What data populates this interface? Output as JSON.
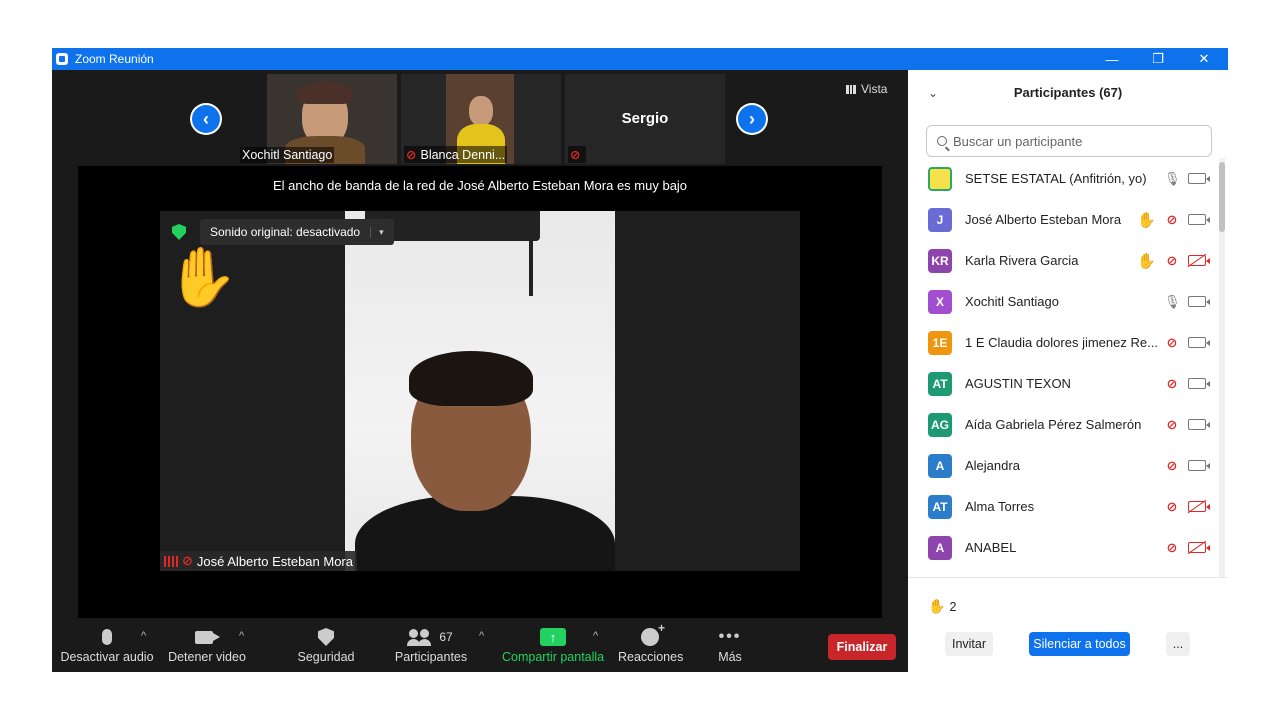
{
  "window": {
    "title": "Zoom Reunión",
    "controls": {
      "minimize": "—",
      "restore": "❐",
      "close": "✕"
    }
  },
  "video_strip": {
    "prev_icon": "‹",
    "next_icon": "›",
    "thumbnails": [
      {
        "name": "Xochitl Santiago",
        "muted": false
      },
      {
        "name": "Blanca Denni...",
        "muted": true
      },
      {
        "name": "Sergio",
        "muted": true,
        "centered_name": true
      }
    ],
    "view_button": "Vista"
  },
  "stage": {
    "bandwidth_banner": "El ancho de banda de la red de José Alberto Esteban Mora es muy bajo",
    "sound_chip": "Sonido original: desactivado",
    "sound_chip_caret": "▾",
    "hand_emoji": "✋",
    "speaker_name": "José Alberto Esteban Mora"
  },
  "toolbar": {
    "mute_audio": "Desactivar audio",
    "stop_video": "Detener video",
    "security": "Seguridad",
    "participants": "Participantes",
    "participants_count": "67",
    "share_screen": "Compartir pantalla",
    "reactions": "Reacciones",
    "more": "Más",
    "end": "Finalizar",
    "caret": "^",
    "dots": "•••",
    "share_arrow": "↑"
  },
  "panel": {
    "chevron": "⌄",
    "title": "Participantes (67)",
    "search_placeholder": "Buscar un participante",
    "participants": [
      {
        "initials": "",
        "name": "SETSE ESTATAL (Anfitrión, yo)",
        "color": "#f5e24a",
        "hand": false,
        "mic": "on",
        "cam": "on",
        "logo": true
      },
      {
        "initials": "J",
        "name": "José Alberto Esteban Mora",
        "color": "#6b6bd6",
        "hand": true,
        "mic": "off",
        "cam": "on"
      },
      {
        "initials": "KR",
        "name": "Karla Rivera Garcia",
        "color": "#8e44ad",
        "hand": true,
        "mic": "off",
        "cam": "off"
      },
      {
        "initials": "X",
        "name": "Xochitl Santiago",
        "color": "#a24ed0",
        "hand": false,
        "mic": "on",
        "cam": "on"
      },
      {
        "initials": "1E",
        "name": "1 E Claudia dolores jimenez Re...",
        "color": "#f0950f",
        "hand": false,
        "mic": "off",
        "cam": "on"
      },
      {
        "initials": "AT",
        "name": "AGUSTIN TEXON",
        "color": "#1d9a74",
        "hand": false,
        "mic": "off",
        "cam": "on"
      },
      {
        "initials": "AG",
        "name": "Aída Gabriela Pérez Salmerón",
        "color": "#1d9a74",
        "hand": false,
        "mic": "off",
        "cam": "on"
      },
      {
        "initials": "A",
        "name": "Alejandra",
        "color": "#2b7cc9",
        "hand": false,
        "mic": "off",
        "cam": "on"
      },
      {
        "initials": "AT",
        "name": "Alma Torres",
        "color": "#2b7cc9",
        "hand": false,
        "mic": "off",
        "cam": "off"
      },
      {
        "initials": "A",
        "name": "ANABEL",
        "color": "#8e44ad",
        "hand": false,
        "mic": "off",
        "cam": "off"
      }
    ],
    "raised_hands_icon": "✋",
    "raised_hands_count": "2",
    "invite": "Invitar",
    "mute_all": "Silenciar a todos",
    "more": "..."
  },
  "colors": {
    "titlebar": "#0e72ed",
    "end_button": "#c8262b",
    "share": "#23d160",
    "muted_red": "#e02828"
  }
}
